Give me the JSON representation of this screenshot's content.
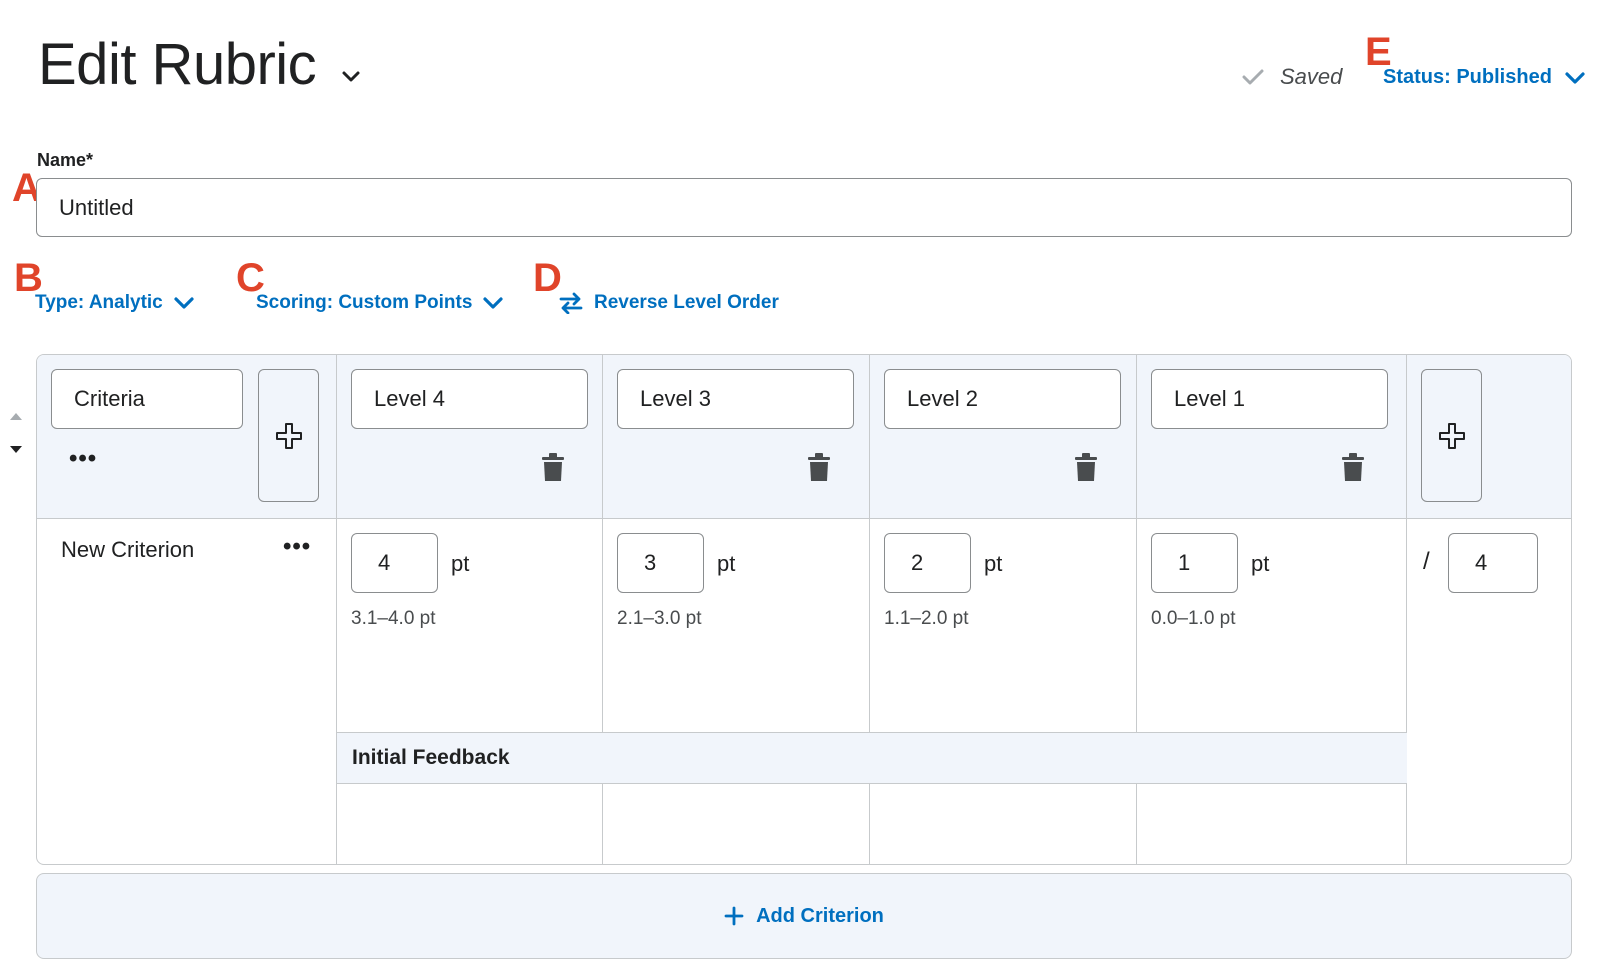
{
  "header": {
    "title": "Edit Rubric",
    "saved_label": "Saved",
    "status_label": "Status: Published"
  },
  "markers": {
    "a": "A",
    "b": "B",
    "c": "C",
    "d": "D",
    "e": "E"
  },
  "name_field": {
    "label": "Name*",
    "value": "Untitled"
  },
  "options": {
    "type_label": "Type: Analytic",
    "scoring_label": "Scoring: Custom Points",
    "reverse_label": "Reverse Level Order"
  },
  "rubric": {
    "criteria_header": "Criteria",
    "levels": [
      {
        "name": "Level 4",
        "points": "4",
        "unit": "pt",
        "range": "3.1–4.0 pt"
      },
      {
        "name": "Level 3",
        "points": "3",
        "unit": "pt",
        "range": "2.1–3.0 pt"
      },
      {
        "name": "Level 2",
        "points": "2",
        "unit": "pt",
        "range": "1.1–2.0 pt"
      },
      {
        "name": "Level 1",
        "points": "1",
        "unit": "pt",
        "range": "0.0–1.0 pt"
      }
    ],
    "criterion_name": "New Criterion",
    "more_label": "•••",
    "total_slash": "/",
    "total_value": "4",
    "feedback_label": "Initial Feedback"
  },
  "add_criterion_label": "Add Criterion",
  "colors": {
    "link": "#006fbf",
    "marker": "#e0442a",
    "header_bg": "#f1f5fb",
    "border": "#c7cacc"
  },
  "icons": [
    "chevron-down-icon",
    "check-icon",
    "swap-arrows-icon",
    "plus-icon",
    "trash-icon",
    "more-icon",
    "move-arrows-icon"
  ]
}
